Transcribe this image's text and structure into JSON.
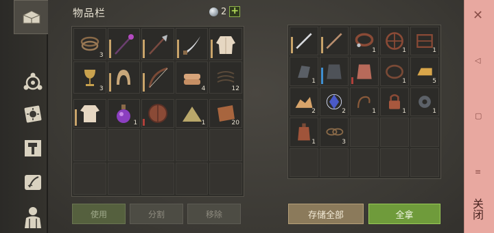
{
  "header": {
    "title": "物品栏",
    "currency_count": "2",
    "plus_label": "+"
  },
  "inventory": {
    "counts": [
      "3",
      "",
      "",
      "",
      "",
      "3",
      "",
      "",
      "4",
      "12",
      "",
      "1",
      "",
      "1",
      "20"
    ]
  },
  "container": {
    "counts": [
      "",
      "",
      "1",
      "1",
      "1",
      "1",
      "",
      "",
      "1",
      "5",
      "2",
      "2",
      "1",
      "1",
      "1",
      "1",
      "3"
    ]
  },
  "buttons": {
    "use": "使用",
    "split": "分割",
    "remove": "移除",
    "store_all": "存储全部",
    "take_all": "全拿"
  },
  "close_panel": {
    "close_x": "✕",
    "back": "◁",
    "home": "▢",
    "menu": "≡",
    "label": "关闭"
  },
  "colors": {
    "take_all_green": "#6f9b3b",
    "store_all_tan": "#8b7a5b",
    "close_strip": "#e8a8a0"
  }
}
